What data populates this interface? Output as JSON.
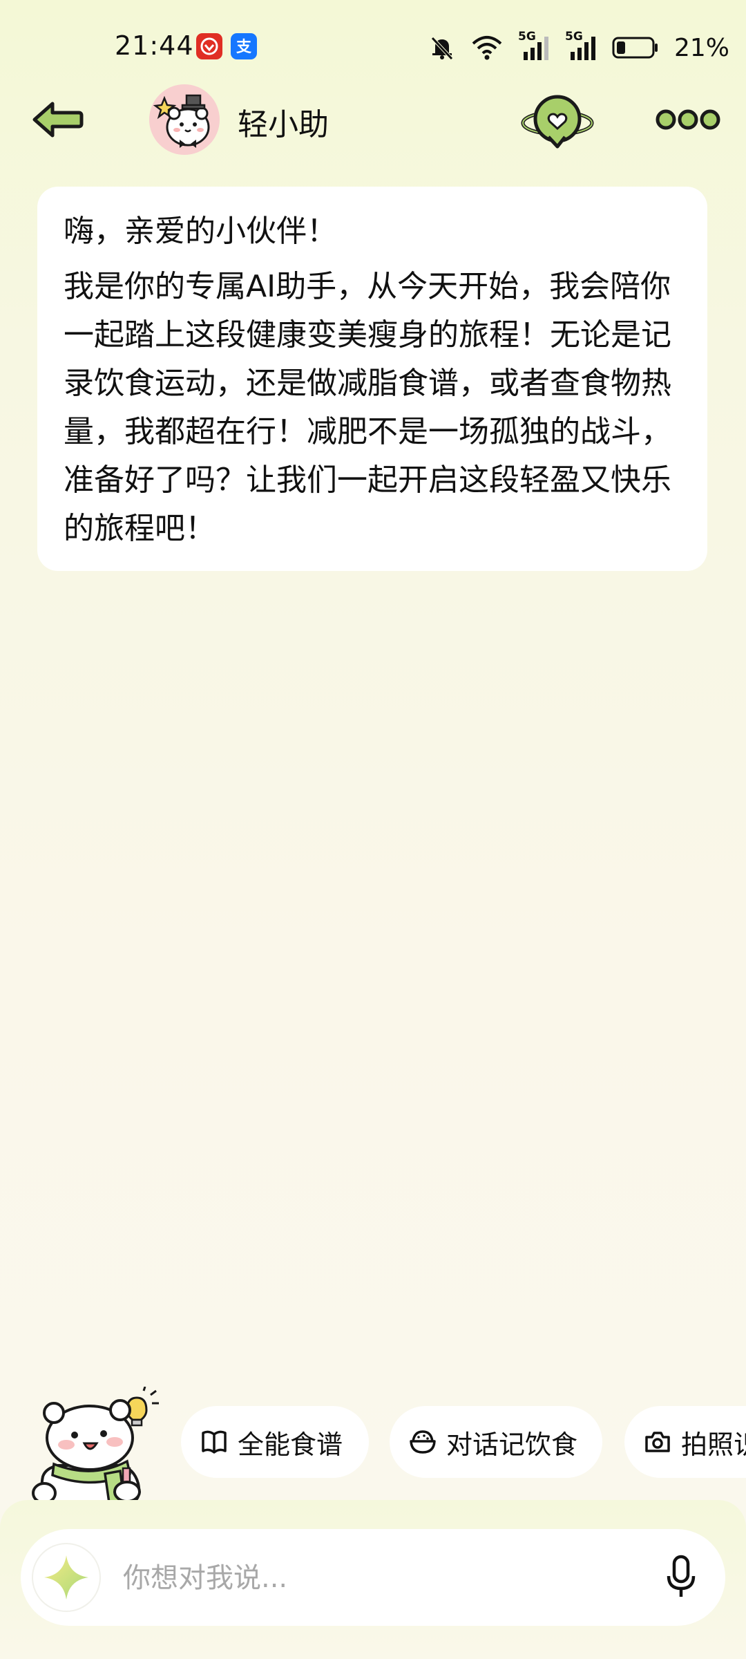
{
  "status_bar": {
    "time": "21:44",
    "app_icons": [
      "pinduoduo-app-icon",
      "alipay-app-icon"
    ],
    "battery_percent": "21%",
    "network_labels": [
      "5G",
      "5G"
    ],
    "icons": [
      "mute-bell-icon",
      "wifi-icon",
      "signal-5g-icon",
      "signal-5g-icon",
      "battery-icon"
    ]
  },
  "header": {
    "title": "轻小助",
    "back_icon": "back-arrow-icon",
    "right_icons": [
      "globe-heart-icon",
      "more-dots-icon"
    ]
  },
  "message": {
    "greeting": "嗨，亲爱的小伙伴！",
    "body": "我是你的专属AI助手，从今天开始，我会陪你一起踏上这段健康变美瘦身的旅程！无论是记录饮食运动，还是做减脂食谱，或者查食物热量，我都超在行！减肥不是一场孤独的战斗，准备好了吗？让我们一起开启这段轻盈又快乐的旅程吧！"
  },
  "quick_actions": [
    {
      "label": "全能食谱",
      "icon": "recipe-book-icon"
    },
    {
      "label": "对话记饮食",
      "icon": "rice-bowl-icon"
    },
    {
      "label": "拍照识",
      "icon": "camera-icon"
    }
  ],
  "input": {
    "placeholder": "你想对我说...",
    "left_icon": "sparkle-icon",
    "right_icon": "microphone-icon"
  },
  "colors": {
    "accent_green": "#a8cf6a",
    "outline": "#1a1a1a",
    "bubble_bg": "#ffffff"
  }
}
